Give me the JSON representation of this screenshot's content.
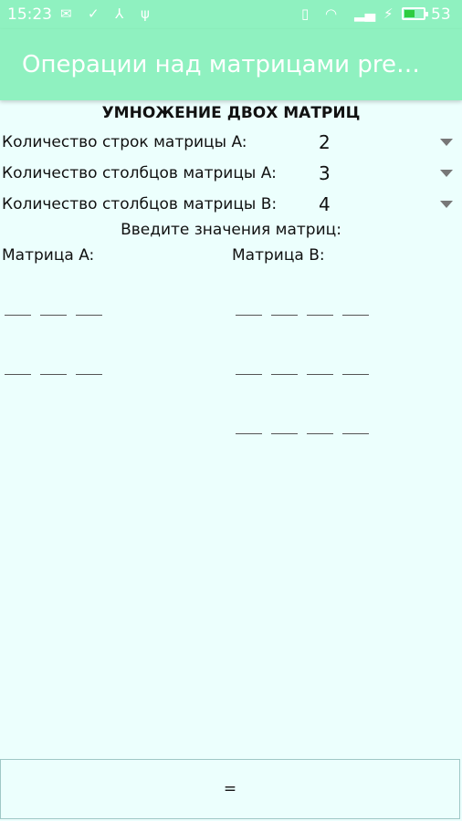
{
  "status_bar": {
    "time": "15:23",
    "battery_percent": "53",
    "battery_level": 0.53,
    "left_icons": [
      "email-icon",
      "check-circle-icon",
      "share-icon",
      "usb-icon"
    ],
    "right_icons": [
      "vibrate-icon",
      "wifi-icon",
      "signal-icon",
      "charging-icon",
      "battery-icon"
    ]
  },
  "app_bar": {
    "title": "Операции над матрицами premi..."
  },
  "main": {
    "heading": "УМНОЖЕНИЕ ДВОХ МАТРИЦ",
    "rows_a": {
      "label": "Количество строк матрицы A:",
      "value": "2"
    },
    "cols_a": {
      "label": "Количество столбцов матрицы A:",
      "value": "3"
    },
    "cols_b": {
      "label": "Количество столбцов матрицы B:",
      "value": "4"
    },
    "enter_values": "Введите значения матриц:",
    "matrix_a_label": "Матрица A:",
    "matrix_b_label": "Матрица B:"
  },
  "matrix_a": {
    "rows": 2,
    "cols": 3
  },
  "matrix_b": {
    "rows": 3,
    "cols": 4
  },
  "button": {
    "label": "="
  },
  "colors": {
    "accent": "#8ff1c0",
    "background": "#ecfffd",
    "text": "#111111",
    "battery_fill": "#2ecc40"
  }
}
